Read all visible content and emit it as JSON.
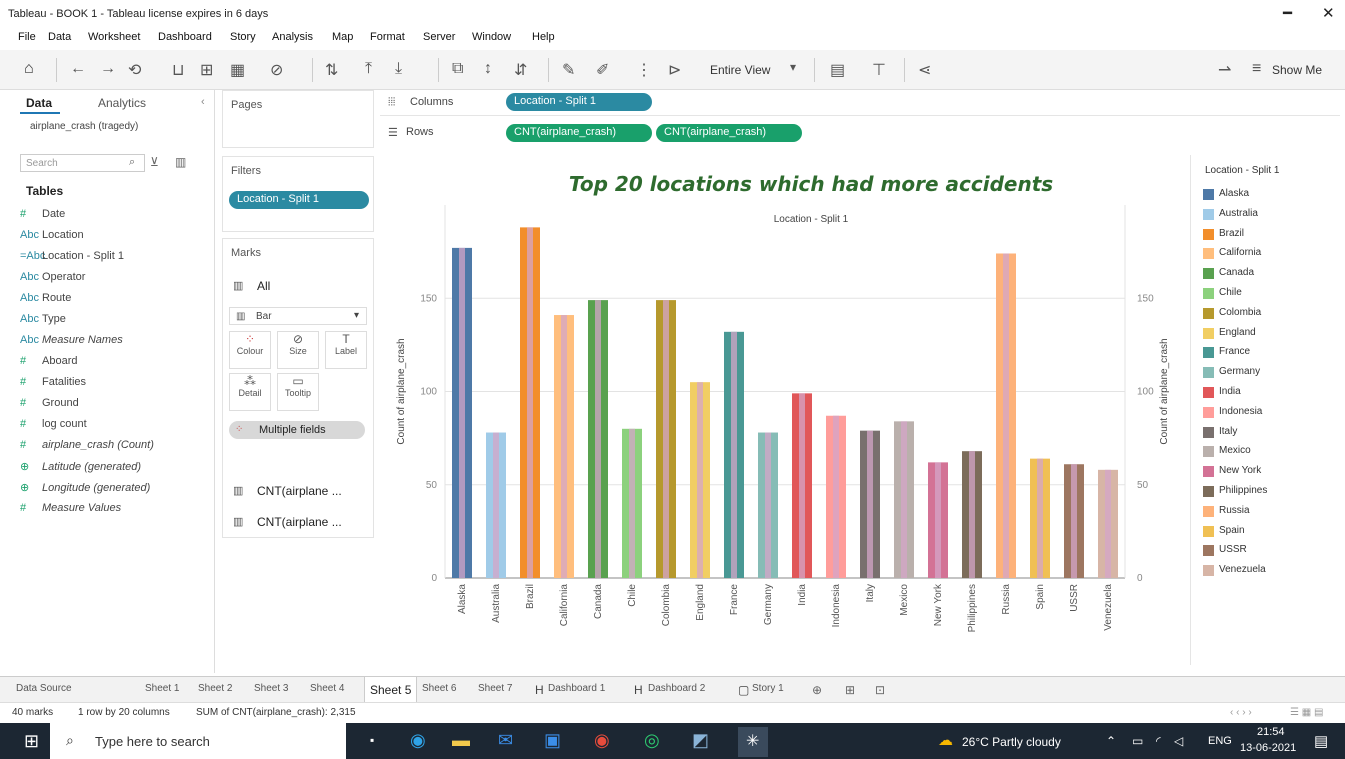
{
  "window": {
    "title": "Tableau - BOOK 1 - Tableau license expires in 6 days"
  },
  "menu": [
    "File",
    "Data",
    "Worksheet",
    "Dashboard",
    "Story",
    "Analysis",
    "Map",
    "Format",
    "Server",
    "Window",
    "Help"
  ],
  "toolbar": {
    "view_label": "Entire View",
    "show_me_label": "Show Me"
  },
  "left_pane": {
    "tabs": [
      "Data",
      "Analytics"
    ],
    "datasource": "airplane_crash (tragedy)",
    "search_placeholder": "Search",
    "tables_label": "Tables",
    "fields": [
      {
        "icon": "#",
        "name": "Date"
      },
      {
        "icon": "Abc",
        "name": "Location"
      },
      {
        "icon": "=Abc",
        "name": "Location - Split 1"
      },
      {
        "icon": "Abc",
        "name": "Operator"
      },
      {
        "icon": "Abc",
        "name": "Route"
      },
      {
        "icon": "Abc",
        "name": "Type"
      },
      {
        "icon": "Abc",
        "name": "Measure Names"
      },
      {
        "icon": "#",
        "name": "Aboard"
      },
      {
        "icon": "#",
        "name": "Fatalities"
      },
      {
        "icon": "#",
        "name": "Ground"
      },
      {
        "icon": "#",
        "name": "log count"
      },
      {
        "icon": "#",
        "name": "airplane_crash (Count)"
      },
      {
        "icon": "⊕",
        "name": "Latitude (generated)"
      },
      {
        "icon": "⊕",
        "name": "Longitude (generated)"
      },
      {
        "icon": "#",
        "name": "Measure Values"
      }
    ]
  },
  "cards": {
    "pages_label": "Pages",
    "filters_label": "Filters",
    "filter_pill": "Location - Split 1",
    "marks_label": "Marks",
    "marks_all": "All",
    "mark_type": "Bar",
    "mark_buttons": [
      "Colour",
      "Size",
      "Label",
      "Detail",
      "Tooltip"
    ],
    "multiple_fields": "Multiple fields",
    "measure_cards": [
      "CNT(airplane ...",
      "CNT(airplane ..."
    ]
  },
  "shelves": {
    "columns_label": "Columns",
    "rows_label": "Rows",
    "columns_pill": "Location - Split 1",
    "rows_pills": [
      "CNT(airplane_crash)",
      "CNT(airplane_crash)"
    ]
  },
  "chart_data": {
    "type": "bar",
    "title": "Top 20 locations which had more accidents",
    "header": "Location - Split 1",
    "ylabel": "Count of airplane_crash",
    "y2label": "Count of airplane_crash",
    "ylim": [
      0,
      200
    ],
    "yticks": [
      0,
      50,
      100,
      150
    ],
    "categories": [
      "Alaska",
      "Australia",
      "Brazil",
      "California",
      "Canada",
      "Chile",
      "Colombia",
      "England",
      "France",
      "Germany",
      "India",
      "Indonesia",
      "Italy",
      "Mexico",
      "New York",
      "Philippines",
      "Russia",
      "Spain",
      "USSR",
      "Venezuela"
    ],
    "values": [
      177,
      78,
      188,
      141,
      149,
      80,
      149,
      105,
      132,
      78,
      99,
      87,
      79,
      84,
      62,
      68,
      174,
      64,
      61,
      58
    ],
    "colors": [
      "#4e79a7",
      "#a0cbe8",
      "#f28e2b",
      "#ffbe7d",
      "#59a14f",
      "#8cd17d",
      "#b6992d",
      "#f1ce63",
      "#499894",
      "#86bcb6",
      "#e15759",
      "#ff9d9a",
      "#79706e",
      "#bab0ac",
      "#d37295",
      "#7c6c5a",
      "#fdb27a",
      "#f0c054",
      "#9d7660",
      "#d7b5a6"
    ],
    "overlay_color": "#d4a6c8",
    "grid": true
  },
  "legend": {
    "title": "Location - Split 1",
    "items": [
      "Alaska",
      "Australia",
      "Brazil",
      "California",
      "Canada",
      "Chile",
      "Colombia",
      "England",
      "France",
      "Germany",
      "India",
      "Indonesia",
      "Italy",
      "Mexico",
      "New York",
      "Philippines",
      "Russia",
      "Spain",
      "USSR",
      "Venezuela"
    ]
  },
  "sheet_tabs": [
    "Data Source",
    "Sheet 1",
    "Sheet 2",
    "Sheet 3",
    "Sheet 4",
    "Sheet 5",
    "Sheet 6",
    "Sheet 7",
    "Dashboard 1",
    "Dashboard 2",
    "Story 1"
  ],
  "active_sheet": "Sheet 5",
  "status": {
    "marks": "40 marks",
    "rows_cols": "1 row by 20 columns",
    "sum": "SUM of CNT(airplane_crash): 2,315"
  },
  "taskbar": {
    "search_placeholder": "Type here to search",
    "weather": "26°C  Partly cloudy",
    "lang": "ENG",
    "time": "21:54",
    "date": "13-06-2021"
  }
}
